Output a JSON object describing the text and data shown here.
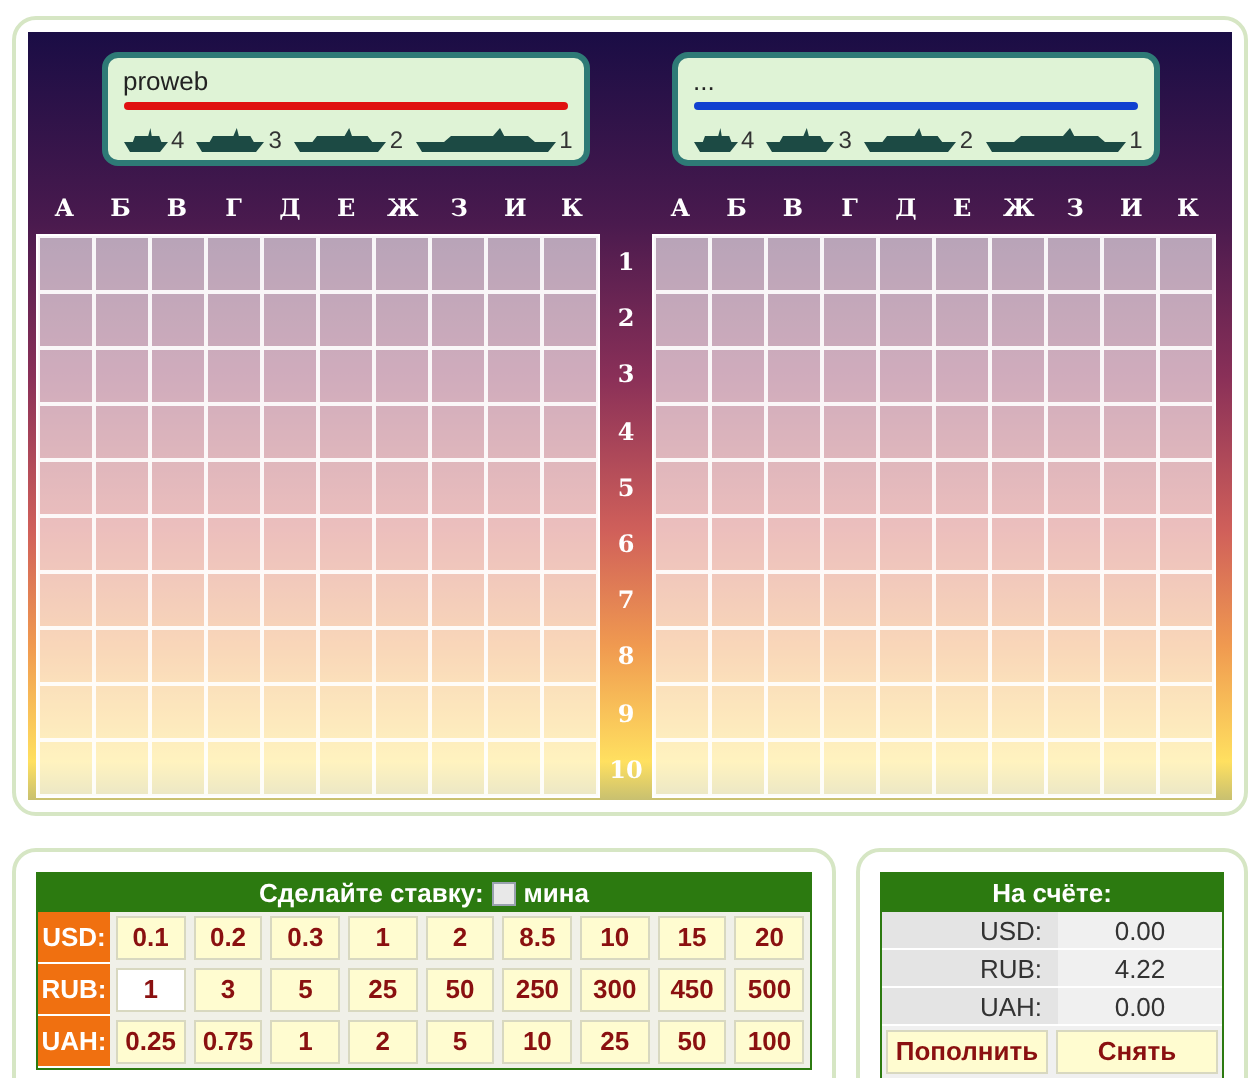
{
  "players": [
    {
      "name": "proweb",
      "color": "#e01010",
      "ships": [
        {
          "count": "4"
        },
        {
          "count": "3"
        },
        {
          "count": "2"
        },
        {
          "count": "1"
        }
      ]
    },
    {
      "name": "...",
      "color": "#1040d0",
      "ships": [
        {
          "count": "4"
        },
        {
          "count": "3"
        },
        {
          "count": "2"
        },
        {
          "count": "1"
        }
      ]
    }
  ],
  "boards": [
    {
      "column_labels": [
        "А",
        "Б",
        "В",
        "Г",
        "Д",
        "Е",
        "Ж",
        "З",
        "И",
        "К"
      ]
    },
    {
      "column_labels": [
        "А",
        "Б",
        "В",
        "Г",
        "Д",
        "Е",
        "Ж",
        "З",
        "И",
        "К"
      ]
    }
  ],
  "row_labels": [
    "1",
    "2",
    "3",
    "4",
    "5",
    "6",
    "7",
    "8",
    "9",
    "10"
  ],
  "bet": {
    "title": "Сделайте ставку:",
    "mine_label": "мина",
    "mine_checked": false,
    "rows": [
      {
        "currency": "USD:",
        "amounts": [
          {
            "label": "0.1",
            "selected": false
          },
          {
            "label": "0.2",
            "selected": false
          },
          {
            "label": "0.3",
            "selected": false
          },
          {
            "label": "1",
            "selected": false
          },
          {
            "label": "2",
            "selected": false
          },
          {
            "label": "8.5",
            "selected": false
          },
          {
            "label": "10",
            "selected": false
          },
          {
            "label": "15",
            "selected": false
          },
          {
            "label": "20",
            "selected": false
          }
        ]
      },
      {
        "currency": "RUB:",
        "amounts": [
          {
            "label": "1",
            "selected": true
          },
          {
            "label": "3",
            "selected": false
          },
          {
            "label": "5",
            "selected": false
          },
          {
            "label": "25",
            "selected": false
          },
          {
            "label": "50",
            "selected": false
          },
          {
            "label": "250",
            "selected": false
          },
          {
            "label": "300",
            "selected": false
          },
          {
            "label": "450",
            "selected": false
          },
          {
            "label": "500",
            "selected": false
          }
        ]
      },
      {
        "currency": "UAH:",
        "amounts": [
          {
            "label": "0.25",
            "selected": false
          },
          {
            "label": "0.75",
            "selected": false
          },
          {
            "label": "1",
            "selected": false
          },
          {
            "label": "2",
            "selected": false
          },
          {
            "label": "5",
            "selected": false
          },
          {
            "label": "10",
            "selected": false
          },
          {
            "label": "25",
            "selected": false
          },
          {
            "label": "50",
            "selected": false
          },
          {
            "label": "100",
            "selected": false
          }
        ]
      }
    ]
  },
  "balance": {
    "title": "На счёте:",
    "rows": [
      {
        "currency": "USD:",
        "amount": "0.00"
      },
      {
        "currency": "RUB:",
        "amount": "4.22"
      },
      {
        "currency": "UAH:",
        "amount": "0.00"
      }
    ],
    "buttons": [
      "Пополнить",
      "Снять"
    ]
  }
}
